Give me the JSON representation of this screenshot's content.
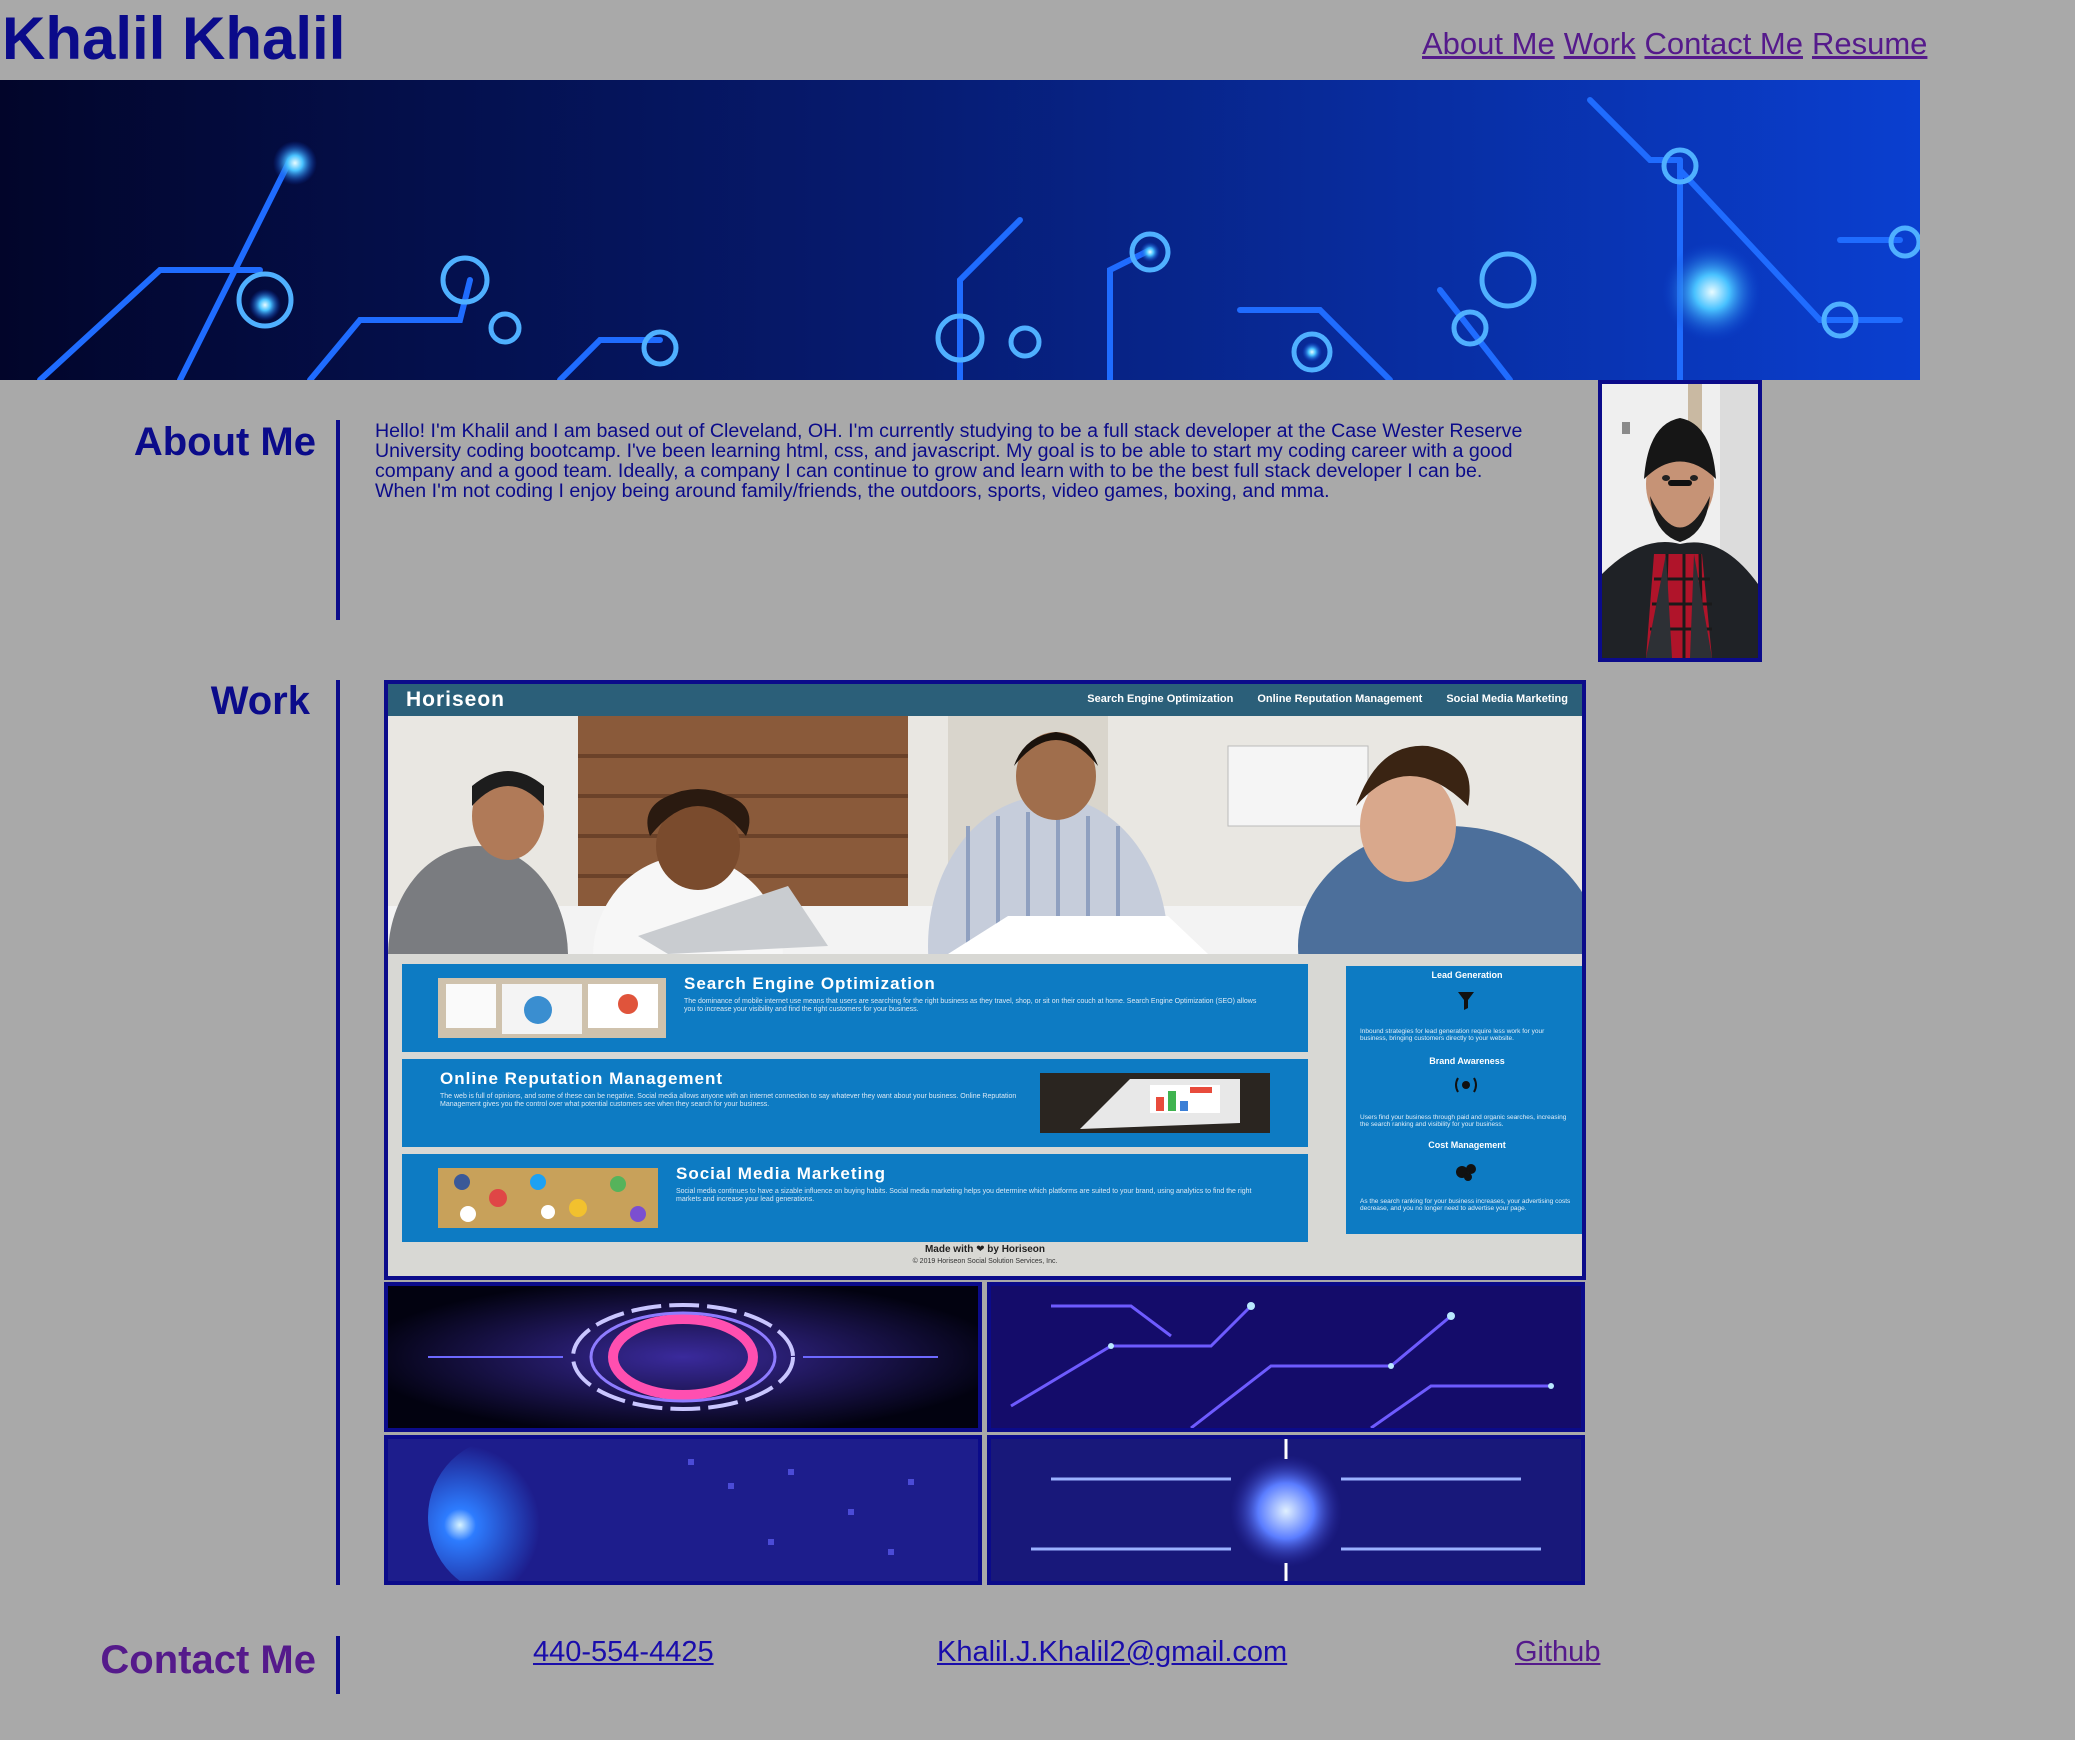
{
  "header": {
    "site_title": "Khalil Khalil",
    "nav": [
      "About Me",
      "Work",
      "Contact Me",
      "Resume"
    ]
  },
  "about": {
    "heading": "About Me",
    "bio": "Hello! I'm Khalil and I am based out of Cleveland, OH. I'm currently studying to be a full stack developer at the Case Wester Reserve University coding bootcamp. I've been learning html, css, and javascript. My goal is to be able to start my coding career with a good company and a good team. Ideally, a company I can continue to grow and learn with to be the best full stack developer I can be. When I'm not coding I enjoy being around family/friends, the outdoors, sports, video games, boxing, and mma."
  },
  "work": {
    "heading": "Work",
    "featured": {
      "brand": "Horiseon",
      "nav": [
        "Search Engine Optimization",
        "Online Reputation Management",
        "Social Media Marketing"
      ],
      "cards": [
        {
          "title": "Search Engine Optimization",
          "text": "The dominance of mobile internet use means that users are searching for the right business as they travel, shop, or sit on their couch at home. Search Engine Optimization (SEO) allows you to increase your visibility and find the right customers for your business."
        },
        {
          "title": "Online Reputation Management",
          "text": "The web is full of opinions, and some of these can be negative. Social media allows anyone with an internet connection to say whatever they want about your business. Online Reputation Management gives you the control over what potential customers see when they search for your business."
        },
        {
          "title": "Social Media Marketing",
          "text": "Social media continues to have a sizable influence on buying habits. Social media marketing helps you determine which platforms are suited to your brand, using analytics to find the right markets and increase your lead generations."
        }
      ],
      "sidebar": [
        {
          "title": "Lead Generation",
          "text": "Inbound strategies for lead generation require less work for your business, bringing customers directly to your website."
        },
        {
          "title": "Brand Awareness",
          "text": "Users find your business through paid and organic searches, increasing the search ranking and visibility for your business."
        },
        {
          "title": "Cost Management",
          "text": "As the search ranking for your business increases, your advertising costs decrease, and you no longer need to advertise your page."
        }
      ],
      "footer_made": "Made with ❤ by Horiseon",
      "footer_copy": "© 2019 Horiseon Social Solution Services, Inc."
    }
  },
  "contact": {
    "heading": "Contact Me",
    "phone": "440-554-4425",
    "email": "Khalil.J.Khalil2@gmail.com",
    "github": "Github"
  },
  "colors": {
    "background": "#a9a9a9",
    "primary_text": "#0b0b8a",
    "link_visited": "#551a8b",
    "link": "#1a0dab",
    "horiseon_blue": "#0d7bc3"
  }
}
